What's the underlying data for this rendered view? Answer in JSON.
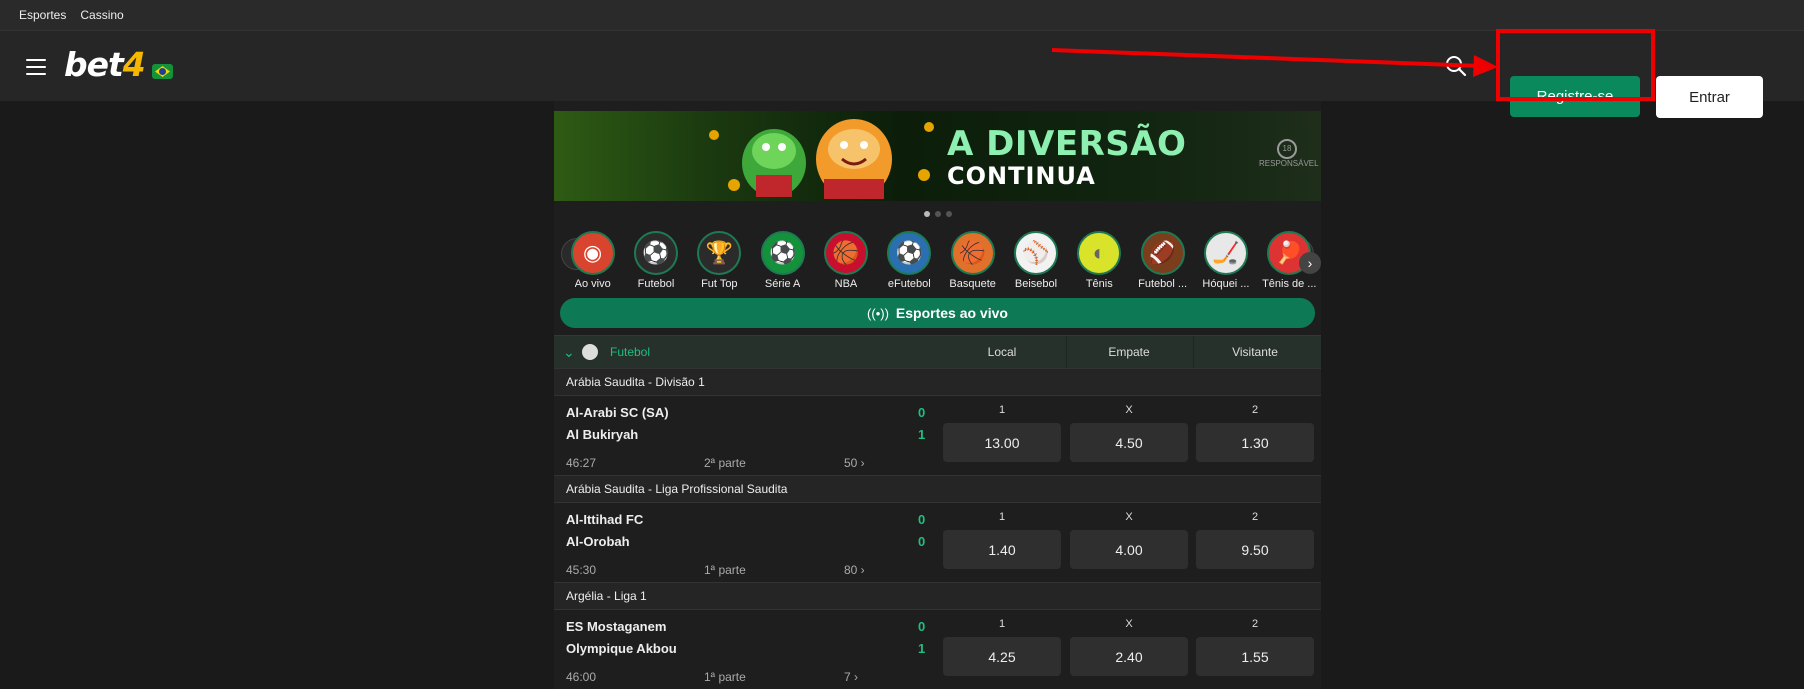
{
  "topnav": {
    "items": [
      "Esportes",
      "Cassino"
    ]
  },
  "header": {
    "logo_main": "bet",
    "logo_num": "4",
    "register_label": "Registre-se",
    "login_label": "Entrar"
  },
  "banner": {
    "line1": "A DIVERSÃO",
    "line2": "CONTINUA",
    "badge": "RESPONSÁVEL"
  },
  "sports": [
    {
      "label": "Ao vivo",
      "icon": "live-icon"
    },
    {
      "label": "Futebol",
      "icon": "soccer-ball-icon"
    },
    {
      "label": "Fut Top",
      "icon": "trophy-icon"
    },
    {
      "label": "Série A",
      "icon": "brazil-ball-icon"
    },
    {
      "label": "NBA",
      "icon": "nba-icon"
    },
    {
      "label": "eFutebol",
      "icon": "efootball-icon"
    },
    {
      "label": "Basquete",
      "icon": "basketball-icon"
    },
    {
      "label": "Beisebol",
      "icon": "baseball-icon"
    },
    {
      "label": "Tênis",
      "icon": "tennis-ball-icon"
    },
    {
      "label": "Futebol ...",
      "icon": "american-football-icon"
    },
    {
      "label": "Hóquei ...",
      "icon": "hockey-icon"
    },
    {
      "label": "Tênis de ...",
      "icon": "table-tennis-icon"
    }
  ],
  "live_bar": {
    "label": "Esportes ao vivo"
  },
  "table": {
    "sport": "Futebol",
    "headers": [
      "Local",
      "Empate",
      "Visitante"
    ],
    "odd_labels": [
      "1",
      "X",
      "2"
    ]
  },
  "leagues": [
    {
      "name": "Arábia Saudita - Divisão 1",
      "match": {
        "home": "Al-Arabi SC (SA)",
        "away": "Al Bukiryah",
        "home_score": "0",
        "away_score": "1",
        "time": "46:27",
        "part": "2ª parte",
        "more": "50 ›",
        "odds": [
          "13.00",
          "4.50",
          "1.30"
        ]
      }
    },
    {
      "name": "Arábia Saudita - Liga Profissional Saudita",
      "match": {
        "home": "Al-Ittihad FC",
        "away": "Al-Orobah",
        "home_score": "0",
        "away_score": "0",
        "time": "45:30",
        "part": "1ª parte",
        "more": "80 ›",
        "odds": [
          "1.40",
          "4.00",
          "9.50"
        ]
      }
    },
    {
      "name": "Argélia - Liga 1",
      "match": {
        "home": "ES Mostaganem",
        "away": "Olympique Akbou",
        "home_score": "0",
        "away_score": "1",
        "time": "46:00",
        "part": "1ª parte",
        "more": "7 ›",
        "odds": [
          "4.25",
          "2.40",
          "1.55"
        ]
      }
    }
  ],
  "colors": {
    "accent": "#0a8a5c",
    "score": "#1fbf80",
    "highlight": "#ee0000"
  }
}
